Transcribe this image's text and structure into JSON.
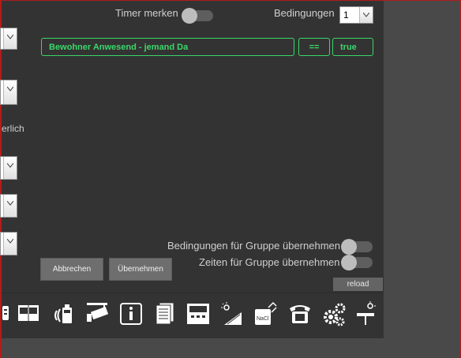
{
  "header": {
    "timer_label": "Timer merken",
    "conditions_label": "Bedingungen",
    "conditions_count": "1"
  },
  "condition": {
    "name": "Bewohner Anwesend - jemand Da",
    "operator": "==",
    "value": "true"
  },
  "left_fragments": {
    "erlich": "erlich"
  },
  "group_options": {
    "conditions_group_label": "Bedingungen für Gruppe übernehmen",
    "times_group_label": "Zeiten für Gruppe übernehmen"
  },
  "buttons": {
    "cancel": "Abbrechen",
    "apply": "Übernehmen",
    "reload": "reload"
  },
  "toolbar_icons": [
    "remote-icon",
    "book-icon",
    "intercom-icon",
    "camera-icon",
    "info-icon",
    "documents-icon",
    "display-panel-icon",
    "solar-icon",
    "salt-icon",
    "phone-icon",
    "settings-gears-icon",
    "weather-station-icon"
  ],
  "colors": {
    "accent_green": "#3ad768",
    "panel_bg": "#333333",
    "button_bg": "#6e6e6e"
  }
}
